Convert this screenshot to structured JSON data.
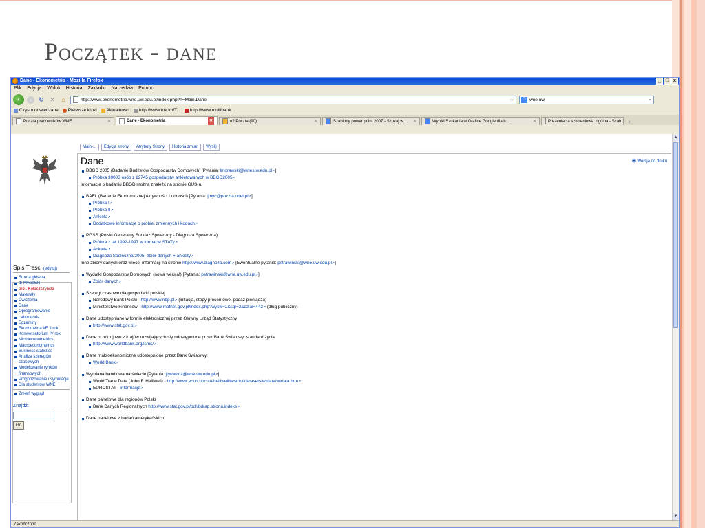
{
  "slide": {
    "title": "Początek - dane"
  },
  "browser": {
    "window_title": "Dane - Ekonometria - Mozilla Firefox",
    "window_buttons": [
      "_",
      "□",
      "x"
    ],
    "menu": [
      "Plik",
      "Edycja",
      "Widok",
      "Historia",
      "Zakładki",
      "Narzędzia",
      "Pomoc"
    ],
    "url": "http://www.ekonometria.wne.uw.edu.pl/index.php?n=Main.Dane",
    "search_value": "wne uw",
    "bookmarks": [
      "Często odwiedzane",
      "Pierwsze kroki",
      "Aktualności",
      "http://www.tok.fm/T...",
      "http://www.multibank..."
    ],
    "tabs": [
      {
        "label": "Poczta pracowników WNE",
        "active": false
      },
      {
        "label": "Dane - Ekonometria",
        "active": true
      },
      {
        "label": "o2 Poczta (90)",
        "active": false
      },
      {
        "label": "Szablony power point 2007 - Szukaj w ...",
        "active": false
      },
      {
        "label": "Wyniki Szukania w Grafice Google dla h...",
        "active": false
      },
      {
        "label": "Prezentacja szkoleniowa: ogólna - Szab...",
        "active": false
      }
    ],
    "status": "Zakończono"
  },
  "wiki": {
    "page_tabs": [
      "Main-...",
      "Edycja strony",
      "Atrybuty Strony",
      "Historia zmian",
      "Wyślij"
    ],
    "heading": "Dane",
    "print_link": "Wersja do druku",
    "sidebar": {
      "title": "Spis Treści",
      "edit": "(edytuj)",
      "items": [
        {
          "label": "Strona główna",
          "red": false
        },
        {
          "label": "dr Mycielski",
          "red": false
        },
        {
          "label": "prof. Kołoszczyński",
          "red": true
        },
        {
          "label": "Materiały",
          "red": false
        },
        {
          "label": "Ćwiczenia",
          "red": false
        },
        {
          "label": "Dane",
          "red": false
        },
        {
          "label": "Oprogramowanie",
          "red": false
        },
        {
          "label": "Laboratoria",
          "red": false
        },
        {
          "label": "Egzaminy",
          "red": false
        },
        {
          "label": "Ekonometria I/E II rok",
          "red": false
        },
        {
          "label": "Konwersatorium IV rok",
          "red": false
        },
        {
          "label": "Microeconometrics",
          "red": false
        },
        {
          "label": "Macroeconometrics",
          "red": false
        },
        {
          "label": "Business statistics",
          "red": false
        },
        {
          "label": "Analiza szeregów czasowych",
          "red": false
        },
        {
          "label": "Modelowanie rynków finansowych",
          "red": false
        },
        {
          "label": "Prognozowanie i symulacje",
          "red": false
        },
        {
          "label": "Dla studentów WNE",
          "red": false
        }
      ],
      "change_look": "Zmień wygląd",
      "search_label": "Znajdź:",
      "go_label": "Go"
    },
    "content": {
      "bbgd": "BBGD 2005 (Badanie Budżetów Gospodarstw Domowych) [Pytania: ",
      "bbgd_mail": "lmorawski@wne.uw.edu.pl",
      "bbgd_sample": "Próbka 30003 osób z 12745 gospodarstw ankietowanych w BBGD2005",
      "bbgd_info": "Informacje o badaniu BBGD można znaleźć na stronie GUS-u.",
      "bael": "BAEL (Badanie Ekonomicznej Aktywności Ludności) [Pytania: ",
      "bael_mail": "jmyc@poczta.onet.pl",
      "bael_items": [
        "Próbka I",
        "Próbka II",
        "Ankieta",
        "Dodatkowe informacje o próbie, zmiennych i kodach"
      ],
      "pgss": "PGSS (Polski Generalny Sondaż Społeczny - Diagnoza Społeczna)",
      "pgss_items": [
        "Próbka z lat 1992-1997 w formacie STATy",
        "Ankieta",
        "Diagnoza Społeczna 2005: zbiór danych + ankiety"
      ],
      "other_text": "Inne zbiory danych oraz więcej informacji na stronie ",
      "other_link": "http://www.diagnoza.com",
      "other_q": " [Ewentualne pytania: ",
      "other_mail": "pstrawinski@wne.uw.edu.pl",
      "wyd": "Wydatki Gospodarstw Domowych (nowa wersja!) [Pytania: ",
      "wyd_mail": "pstrawinski@wne.uw.edu.pl",
      "wyd_item": "Zbiór danych",
      "szeregi": "Szeregi czasowe dla gospodarki polskiej",
      "nbp_text": "Narodowy Bank Polski - ",
      "nbp_link": "http://www.nbp.pl",
      "nbp_note": " (inflacja, stopy procentowe, podaż pieniądza)",
      "mf_text": "Ministerstwo Finansów - ",
      "mf_link": "http://www.mofnet.gov.pl/index.php?wysw=2&sql=2&dzial=442",
      "mf_note": " (dług publiczny)",
      "gus": "Dane udostępniane w formie elektronicznej przez Główny Urząd Statystyczny",
      "gus_link": "http://www.stat.gov.pl",
      "wb1": "Dane przekrojowe z krajów rozwijających się udostępnione przez Bank Światowy: standard życia",
      "wb1_link": "http://www.worldbank.org/lsms/",
      "wb2": "Dane makroekonomiczne udostępnione przez Bank Światowy:",
      "wb2_link": "World Bank",
      "trade": "Wymiana handlowa na świecie [Pytania: ",
      "trade_mail": "jtyrowicz@wne.uw.edu.pl",
      "wtd_text": "World Trade Data (John F. Helliwell) - ",
      "wtd_link": "http://www.econ.ubc.ca/helliwell/restrict/datasets/wtdata/wtdata.htm",
      "eurostat_text": "EUROSTAT - ",
      "eurostat_link": "informacje",
      "panel": "Dane panelowe dla regionów Polski",
      "bdr_text": "Bank Danych Regionalnych ",
      "bdr_link": "http://www.stat.gov.pl/bdr/bdrap.strona.indeks",
      "us_panel": "Dane panelowe z badań amerykańskich"
    }
  }
}
